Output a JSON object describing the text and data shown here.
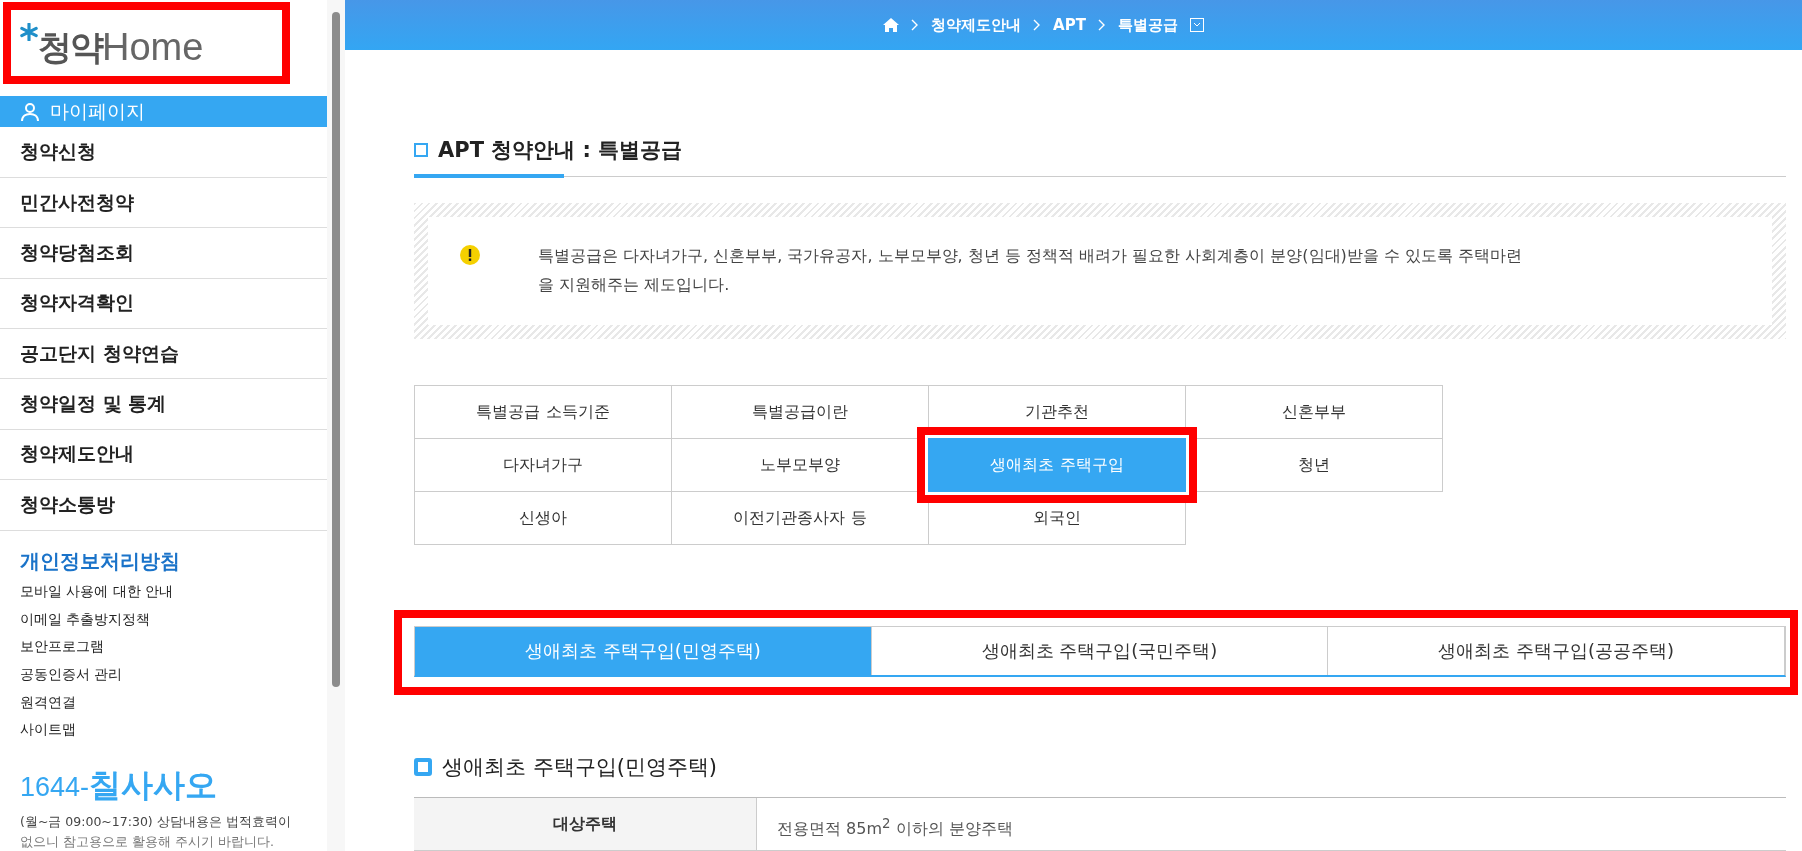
{
  "sidebar": {
    "logo": {
      "text": "청약",
      "text_2": "Home",
      "highlighted": true
    },
    "mypage": {
      "label": "마이페이지",
      "selected": true
    },
    "menu": [
      {
        "label": "청약신청"
      },
      {
        "label": "민간사전청약"
      },
      {
        "label": "청약당첨조회"
      },
      {
        "label": "청약자격확인"
      },
      {
        "label": "공고단지 청약연습"
      },
      {
        "label": "청약일정 및 통계"
      },
      {
        "label": "청약제도안내"
      },
      {
        "label": "청약소통방"
      }
    ],
    "policy": "개인정보처리방침",
    "links": [
      "모바일 사용에 대한 안내",
      "이메일 추출방지정책",
      "보안프로그램",
      "공동인증서 관리",
      "원격연결",
      "사이트맵"
    ],
    "phone": {
      "number": "1644-",
      "word": "칠사사오"
    },
    "hours": "(월~금 09:00~17:30) 상담내용은 법적효력이",
    "hours_cut": "없으니 참고용으로 활용해 주시기 바랍니다."
  },
  "breadcrumb": [
    "청약제도안내",
    "APT",
    "특별공급"
  ],
  "title": "APT 청약안내 : 특별공급",
  "notice": "특별공급은 다자녀가구, 신혼부부, 국가유공자, 노부모부양, 청년 등 정책적 배려가 필요한 사회계층이 분양(임대)받을 수 있도록 주택마련을 지원해주는 제도입니다.",
  "tabs": [
    {
      "label": "특별공급 소득기준",
      "selected": false
    },
    {
      "label": "특별공급이란",
      "selected": false
    },
    {
      "label": "기관추천",
      "selected": false
    },
    {
      "label": "신혼부부",
      "selected": false
    },
    {
      "label": "다자녀가구",
      "selected": false
    },
    {
      "label": "노부모부양",
      "selected": false
    },
    {
      "label": "생애최초 주택구입",
      "selected": true,
      "highlighted": true
    },
    {
      "label": "청년",
      "selected": false
    },
    {
      "label": "신생아",
      "selected": false
    },
    {
      "label": "이전기관종사자 등",
      "selected": false
    },
    {
      "label": "외국인",
      "selected": false
    }
  ],
  "subtabs": {
    "highlighted": true,
    "items": [
      {
        "label": "생애최초 주택구입(민영주택)",
        "selected": true
      },
      {
        "label": "생애최초 주택구입(국민주택)",
        "selected": false
      },
      {
        "label": "생애최초 주택구입(공공주택)",
        "selected": false
      }
    ]
  },
  "section": {
    "heading": "생애최초 주택구입(민영주택)",
    "rows": [
      {
        "label": "대상주택",
        "value": "전용면적 85m$^{2}$ 이하의 분양주택"
      }
    ]
  }
}
